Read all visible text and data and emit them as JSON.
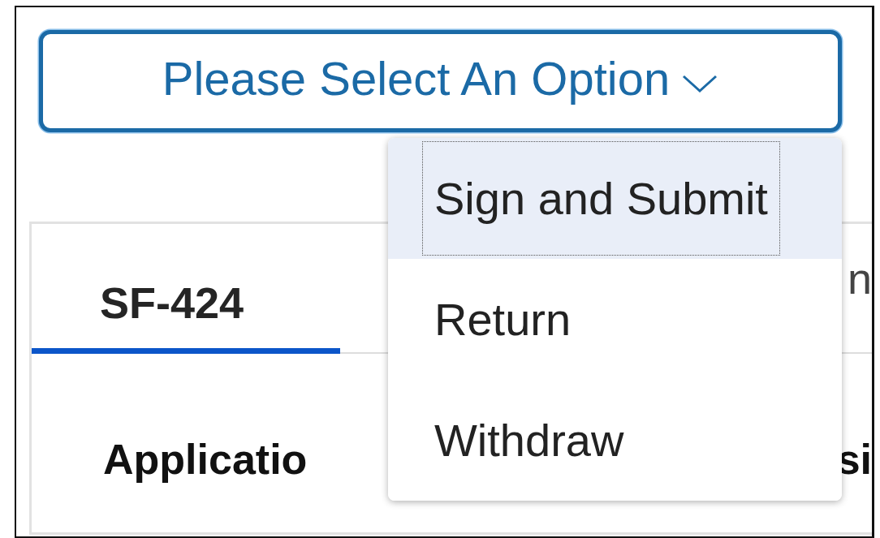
{
  "select": {
    "label": "Please Select An Option",
    "expanded": true,
    "options": [
      {
        "label": "Sign and Submit",
        "selected": true
      },
      {
        "label": "Return",
        "selected": false
      },
      {
        "label": "Withdraw",
        "selected": false
      }
    ]
  },
  "tabs": [
    {
      "label": "SF-424",
      "selected": true
    },
    {
      "label": "n",
      "selected": false
    }
  ],
  "heading_parts": [
    "Applicatio",
    "si"
  ]
}
